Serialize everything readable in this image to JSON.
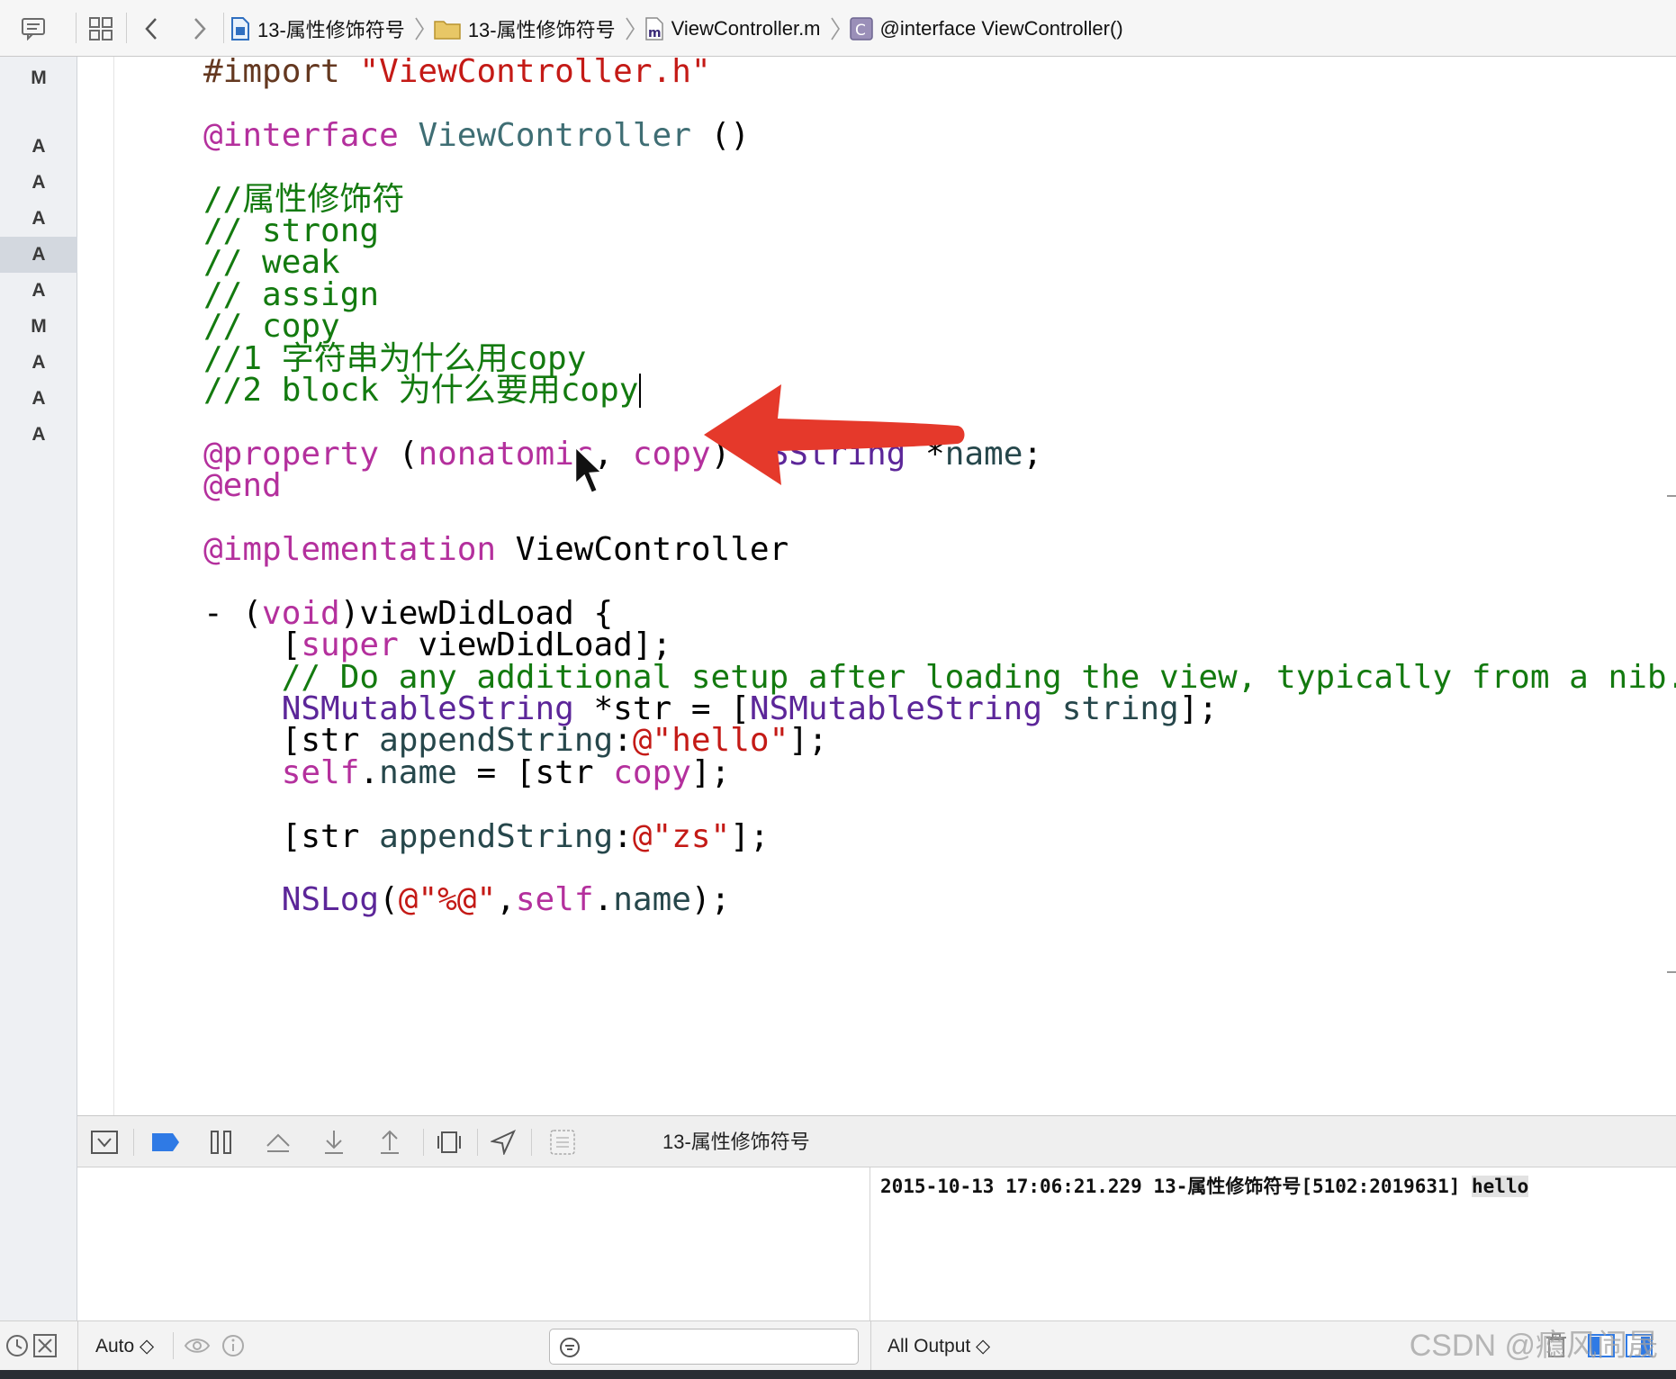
{
  "breadcrumbs": [
    {
      "label": "13-属性修饰符号",
      "icon": "project-file-icon"
    },
    {
      "label": "13-属性修饰符号",
      "icon": "folder-icon"
    },
    {
      "label": "ViewController.m",
      "icon": "m-file-icon"
    },
    {
      "label": "@interface ViewController()",
      "icon": "class-c-icon"
    }
  ],
  "source_control_status": [
    "M",
    "A",
    "A",
    "A",
    "A",
    "A",
    "M",
    "A",
    "A",
    "A"
  ],
  "code_lines": [
    "#import \"ViewController.h\"",
    "",
    "@interface ViewController ()",
    "",
    "//属性修饰符",
    "// strong",
    "// weak",
    "// assign",
    "// copy",
    "//1 字符串为什么用copy",
    "//2 block 为什么要用copy",
    "",
    "@property (nonatomic, copy) NSString *name;",
    "@end",
    "",
    "@implementation ViewController",
    "",
    "- (void)viewDidLoad {",
    "    [super viewDidLoad];",
    "    // Do any additional setup after loading the view, typically from a nib.",
    "    NSMutableString *str = [NSMutableString string];",
    "    [str appendString:@\"hello\"];",
    "    self.name = [str copy];",
    "",
    "    [str appendString:@\"zs\"];",
    "",
    "    NSLog(@\"%@\",self.name);"
  ],
  "debug_bar": {
    "target_label": "13-属性修饰符号"
  },
  "console": {
    "log_prefix": "2015-10-13 17:06:21.229 13-属性修饰符号[5102:2019631] ",
    "log_value": "hello"
  },
  "bottom_bar": {
    "variables_scope": "Auto ◇",
    "output_scope": "All Output ◇"
  },
  "watermark": "CSDN @瘾风闹晟",
  "colors": {
    "keyword": "#b4309d",
    "string": "#c41a16",
    "comment": "#137a0f",
    "type": "#5c2699",
    "annotation_arrow": "#e5392b",
    "breakpoint_blue": "#2f7ae5"
  }
}
